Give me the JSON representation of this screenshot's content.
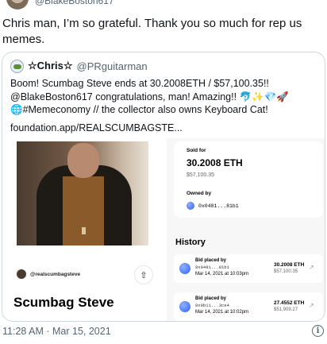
{
  "top": {
    "handle": "@BlakeBoston617"
  },
  "tweet": {
    "text": "Chris man, I’m so grateful. Thank you so much for rep us memes."
  },
  "quote": {
    "name": "☆Chris☆",
    "handle": "@PRguitarman",
    "lines": [
      "Boom! Scumbag Steve ends at 30.2008ETH / $57,100.35!!",
      "@BlakeBoston617 congratulations, man! Amazing!! 🐬✨💎🚀",
      "🌐#Memeconomy // the collector also owns Keyboard Cat!"
    ],
    "link": "foundation.app/REALSCUMBAGSTE..."
  },
  "nft": {
    "creator": "@realscumbagsteve",
    "title": "Scumbag Steve",
    "share_icon": "share-icon",
    "sold_label": "Sold for",
    "sold_eth": "30.2008 ETH",
    "sold_usd": "$57,100.35",
    "owned_label": "Owned by",
    "owner_addr": "0x0481...81b1",
    "history_title": "History",
    "history": [
      {
        "label": "Bid placed by",
        "addr": "0x0481...81b1",
        "date": "Mar 14, 2021 at 10:03pm",
        "eth": "30.2008 ETH",
        "usd": "$57,100.35"
      },
      {
        "label": "Bid placed by",
        "addr": "0x9b11...3ce4",
        "date": "Mar 14, 2021 at 10:02pm",
        "eth": "27.4552 ETH",
        "usd": "$51,909.27"
      }
    ]
  },
  "footer": {
    "timestamp": "11:28 AM · Mar 15, 2021"
  },
  "icons": {
    "info": "i"
  }
}
